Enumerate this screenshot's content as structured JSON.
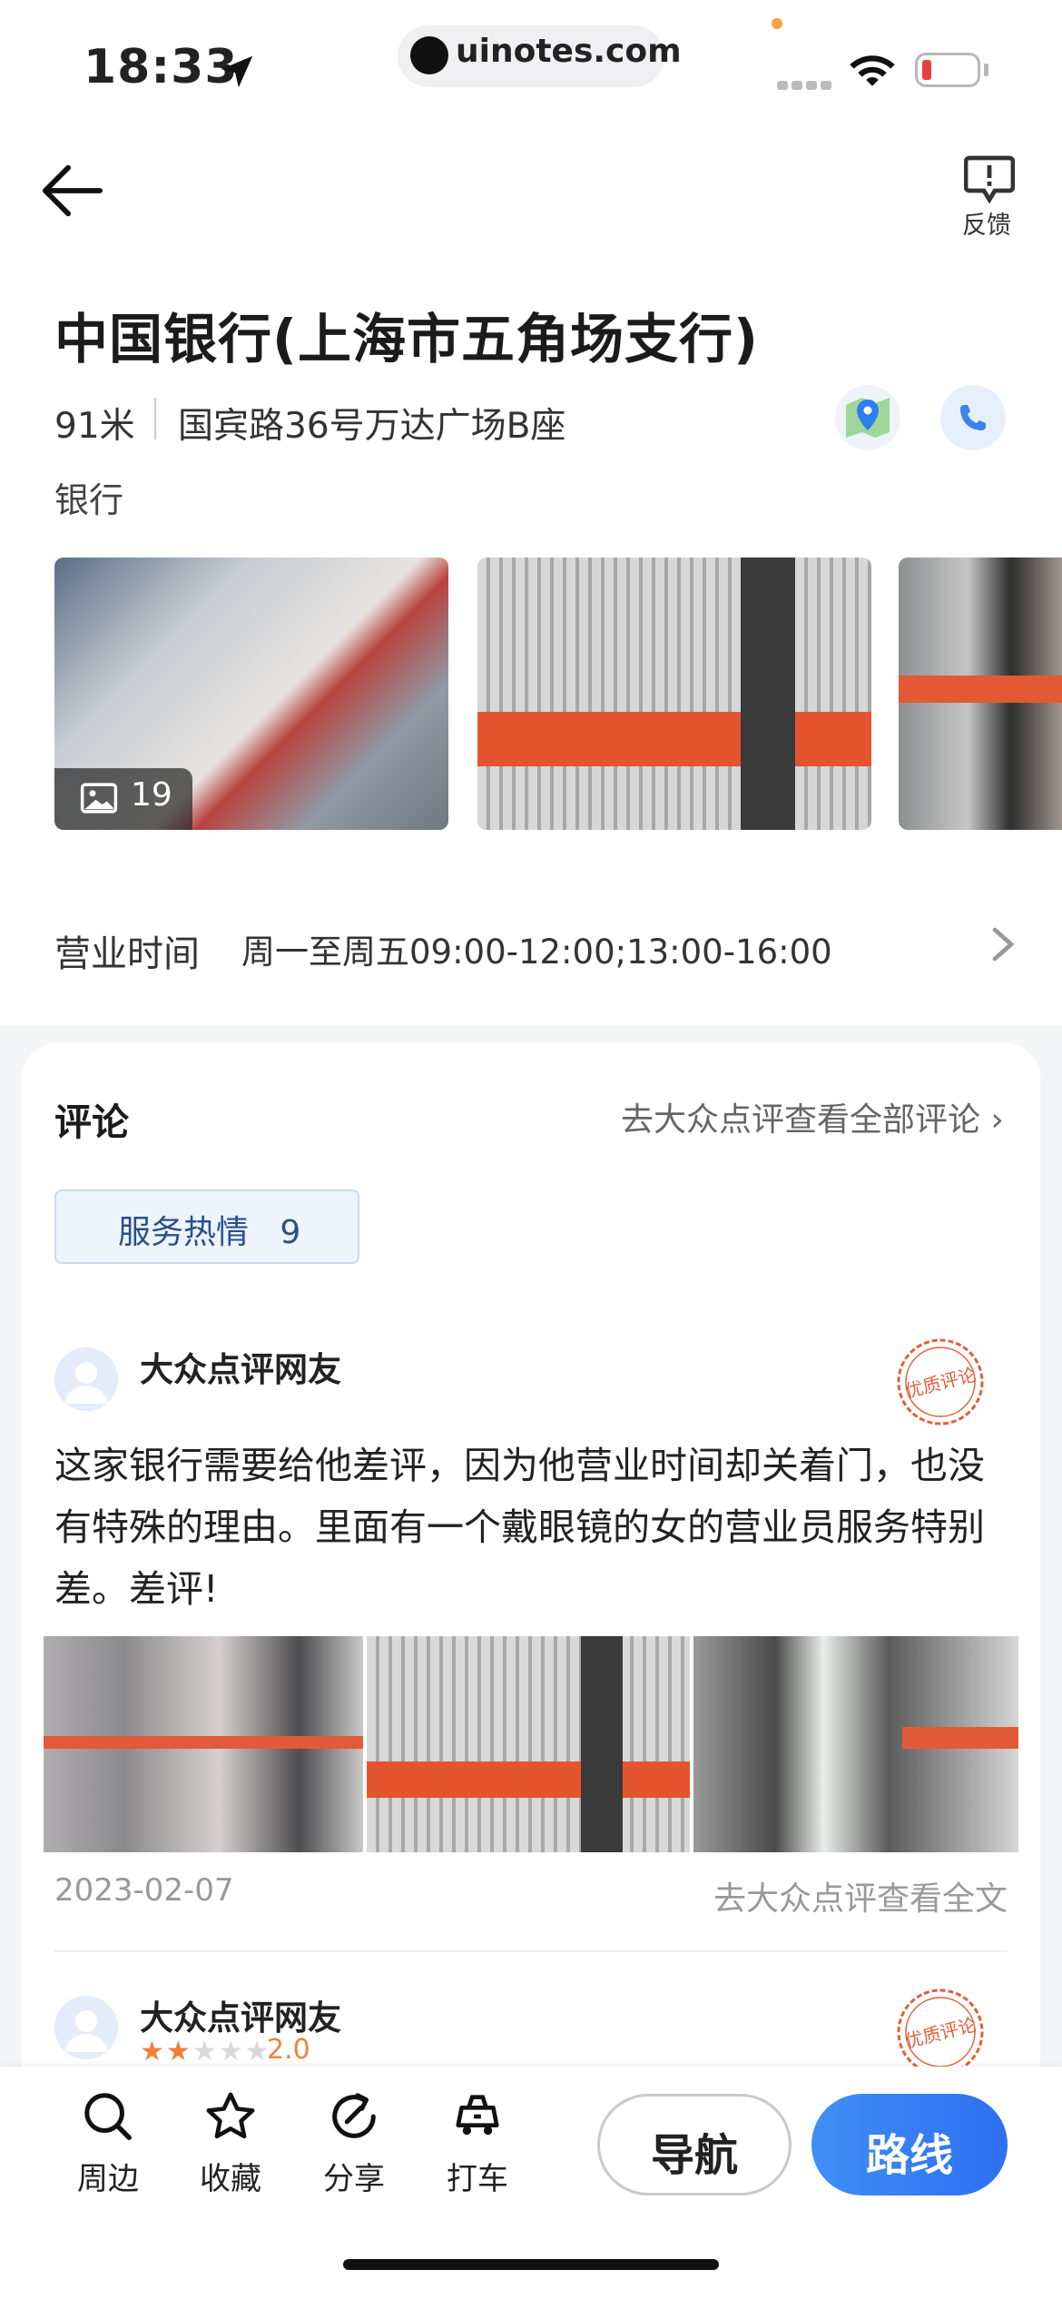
{
  "status_bar": {
    "time": "18:33",
    "url": "uinotes.com"
  },
  "header": {
    "feedback_label": "反馈"
  },
  "poi": {
    "title": "中国银行(上海市五角场支行)",
    "distance": "91米",
    "address": "国宾路36号万达广场B座",
    "category": "银行",
    "photo_count": "19",
    "hours_label": "营业时间",
    "hours_value": "周一至周五09:00-12:00;13:00-16:00"
  },
  "reviews": {
    "title": "评论",
    "view_all_link": "去大众点评查看全部评论 ›",
    "tag": {
      "label": "服务热情",
      "count": "9"
    },
    "items": [
      {
        "user": "大众点评网友",
        "badge": "优质评论",
        "text": "这家银行需要给他差评，因为他营业时间却关着门，也没有特殊的理由。里面有一个戴眼镜的女的营业员服务特别差。差评!",
        "date": "2023-02-07",
        "view_full": "去大众点评查看全文"
      },
      {
        "user": "大众点评网友",
        "badge": "优质评论",
        "stars": 2,
        "rating": "2.0"
      }
    ]
  },
  "toolbar": {
    "items": [
      {
        "label": "周边",
        "icon": "search-icon"
      },
      {
        "label": "收藏",
        "icon": "star-icon"
      },
      {
        "label": "分享",
        "icon": "share-icon"
      },
      {
        "label": "打车",
        "icon": "taxi-icon"
      }
    ],
    "nav_label": "导航",
    "route_label": "路线"
  },
  "colors": {
    "accent_blue": "#2e6ff0",
    "star_orange": "#f3803a",
    "stamp_red": "#e0603a"
  }
}
